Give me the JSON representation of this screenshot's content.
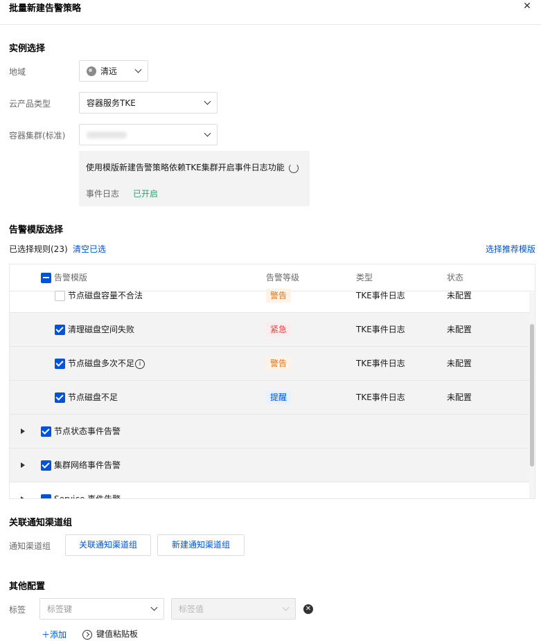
{
  "dialog": {
    "title": "批量新建告警策略",
    "close_icon": "close-icon"
  },
  "instance": {
    "section_title": "实例选择",
    "region_label": "地域",
    "region_value": "清远",
    "product_label": "云产品类型",
    "product_value": "容器服务TKE",
    "cluster_label": "容器集群(标准)",
    "notice_text": "使用模版新建告警策略依赖TKE集群开启事件日志功能",
    "event_log_label": "事件日志",
    "event_log_status": "已开启",
    "status_color": "#2ba471"
  },
  "templates": {
    "section_title": "告警模版选择",
    "selected_count": "已选择规则(23)",
    "clear_link": "清空已选",
    "recommend_link": "选择推荐模版",
    "columns": [
      "告警模版",
      "告警等级",
      "类型",
      "状态"
    ],
    "rows": [
      {
        "name": "节点磁盘容量不合法",
        "level": "警告",
        "type": "TKE事件日志",
        "status": "未配置"
      },
      {
        "name": "清理磁盘空间失败",
        "level": "紧急",
        "type": "TKE事件日志",
        "status": "未配置"
      },
      {
        "name": "节点磁盘多次不足",
        "level": "警告",
        "type": "TKE事件日志",
        "status": "未配置"
      },
      {
        "name": "节点磁盘不足",
        "level": "提醒",
        "type": "TKE事件日志",
        "status": "未配置"
      }
    ],
    "groups": [
      {
        "name": "节点状态事件告警"
      },
      {
        "name": "集群网络事件告警"
      },
      {
        "name": "Service 事件告警"
      }
    ]
  },
  "notify": {
    "section_title": "关联通知渠道组",
    "label": "通知渠道组",
    "link_button": "关联通知渠道组",
    "new_button": "新建通知渠道组"
  },
  "other": {
    "section_title": "其他配置",
    "tag_label": "标签",
    "tag_key_placeholder": "标签键",
    "tag_value_placeholder": "标签值",
    "add_label": "添加",
    "paste_label": "键值粘贴板"
  },
  "accent_color": "#0052d9"
}
